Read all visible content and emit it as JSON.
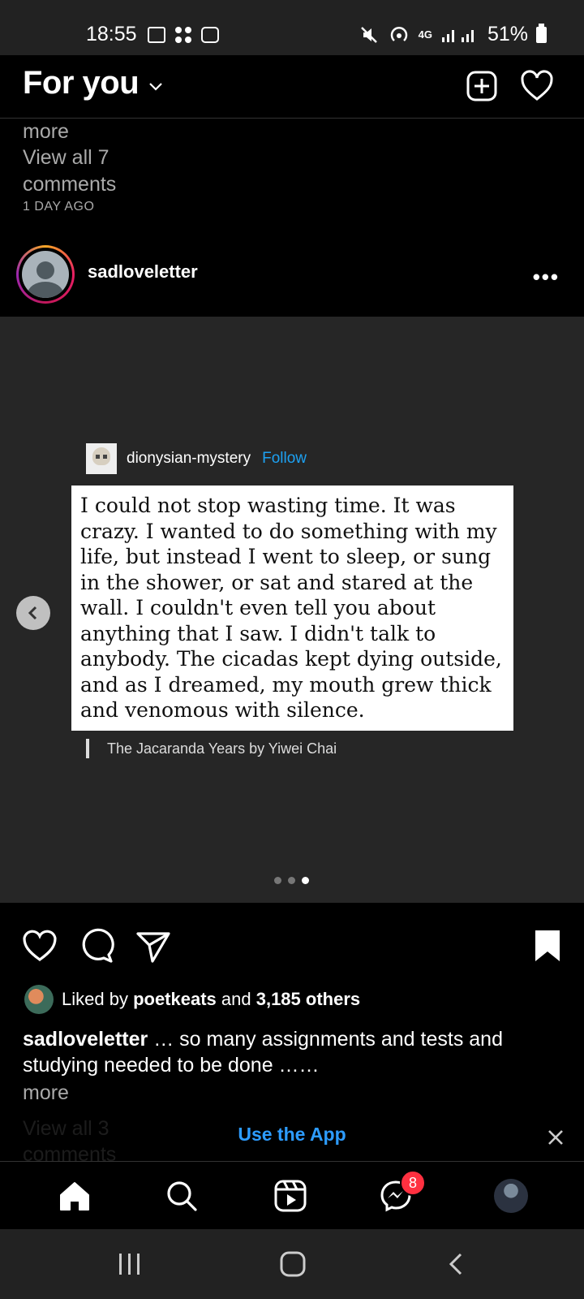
{
  "status_bar": {
    "time": "18:55",
    "network": "4G",
    "battery": "51%"
  },
  "header": {
    "title": "For you",
    "icons": [
      "chevron-down-icon",
      "new-post-icon",
      "heart-icon"
    ]
  },
  "previous_post": {
    "more": "more",
    "view_all": "View all 7 comments",
    "ago": "1 DAY AGO"
  },
  "post": {
    "username": "sadloveletter",
    "quote": {
      "username": "dionysian-mystery",
      "follow": "Follow",
      "text": "I could not stop wasting time. It was crazy. I wanted to do something with my life, but instead I went to sleep, or sung in the shower, or sat and stared at the wall. I couldn't even tell you about anything that I saw. I didn't talk to anybody. The cicadas kept dying outside, and as I dreamed, my mouth grew thick and venomous with silence.",
      "source": "The Jacaranda Years by Yiwei Chai"
    },
    "carousel": {
      "count": 3,
      "active_index": 2
    },
    "likes": {
      "prefix": "Liked by ",
      "user": "poetkeats",
      "middle": " and ",
      "others": "3,185 others"
    },
    "caption": {
      "username": "sadloveletter",
      "text": " … so many assignments and tests and studying needed to be done ……",
      "more": "more"
    },
    "faint_comments": "View all 3 comments"
  },
  "use_app": {
    "label": "Use the App"
  },
  "bottom_nav": {
    "messenger_badge": "8"
  },
  "colors": {
    "accent_blue": "#2d9cff",
    "follow_blue": "#1da1f2",
    "badge_red": "#ff3040",
    "media_bg": "#262626"
  }
}
